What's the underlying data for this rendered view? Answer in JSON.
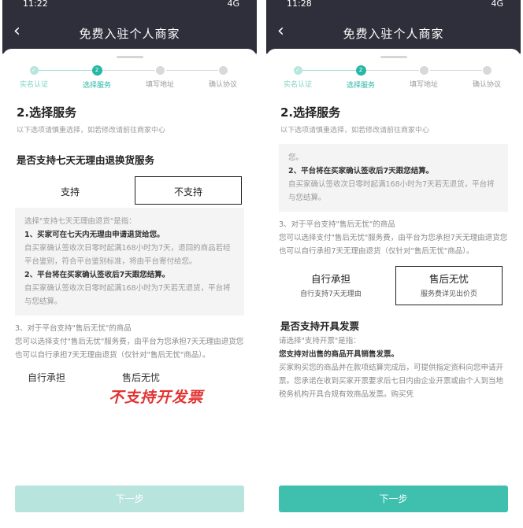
{
  "screens": {
    "left": {
      "status_time": "11:22",
      "status_net": "4G",
      "title": "免费入驻个人商家",
      "steps": [
        "实名认证",
        "选择服务",
        "填写地址",
        "确认协议"
      ],
      "step_number": "2",
      "section_title": "2.选择服务",
      "section_subtitle": "以下选项请慎重选择，如若修改请前往商家中心",
      "question": "是否支持七天无理由退换货服务",
      "option_yes": "支持",
      "option_no": "不支持",
      "info": {
        "intro": "选择\"支持七天无理由退货\"是指：",
        "p1_title": "1、买家可在七天内无理由申请退货给您。",
        "p1_body": "自买家确认签收次日零时起满168小时为7天，退回的商品若经平台鉴别，符合平台鉴别标准，将由平台寄付给您。",
        "p2_title": "2、平台将在买家确认签收后7天跟您结算。",
        "p2_body": "自买家确认签收次日零时起满168小时为7天若无退货，平台将与您结算。"
      },
      "para_title": "3、对于平台支持\"售后无忧\"的商品",
      "para_body": "您可以选择支付\"售后无忧\"服务费，由平台为您承担7天无理由退货您也可以自行承担7天无理由退货（仅针对\"售后无忧\"商品）。",
      "partial_options": "自行承担　　　　　　售后无忧",
      "next_button": "下一步"
    },
    "right": {
      "status_time": "11:28",
      "status_net": "4G",
      "title": "免费入驻个人商家",
      "steps": [
        "实名认证",
        "选择服务",
        "填写地址",
        "确认协议"
      ],
      "step_number": "2",
      "section_title": "2.选择服务",
      "section_subtitle": "以下选项请慎重选择，如若修改请前往商家中心",
      "info": {
        "line0": "您。",
        "p2_title": "2、平台将在买家确认签收后7天跟您结算。",
        "p2_body": "自买家确认签收次日零时起满168小时为7天若无退货，平台将与您结算。"
      },
      "para_title": "3、对于平台支持\"售后无忧\"的商品",
      "para_body": "您可以选择支付\"售后无忧\"服务费，由平台为您承担7天无理由退货您也可以自行承担7天无理由退货（仅针对\"售后无忧\"商品）。",
      "option_self": "自行承担",
      "option_self_sub": "自行支持7天无理由",
      "option_service": "售后无忧",
      "option_service_sub": "服务费详见出价页",
      "invoice_question": "是否支持开具发票",
      "invoice_intro": "请选择\"支持开票\"是指：",
      "invoice_bold": "您支持对出售的商品开具销售发票。",
      "invoice_body": "买家购买您的商品并在款项结算完成后，可提供指定资料向您申请开票。您承诺在收到买家开票要求后七日内由企业开票或由个人到当地税务机构开具合规有效商品发票。购买凭",
      "annotation": "不支持开发票",
      "next_button": "下一步"
    }
  }
}
